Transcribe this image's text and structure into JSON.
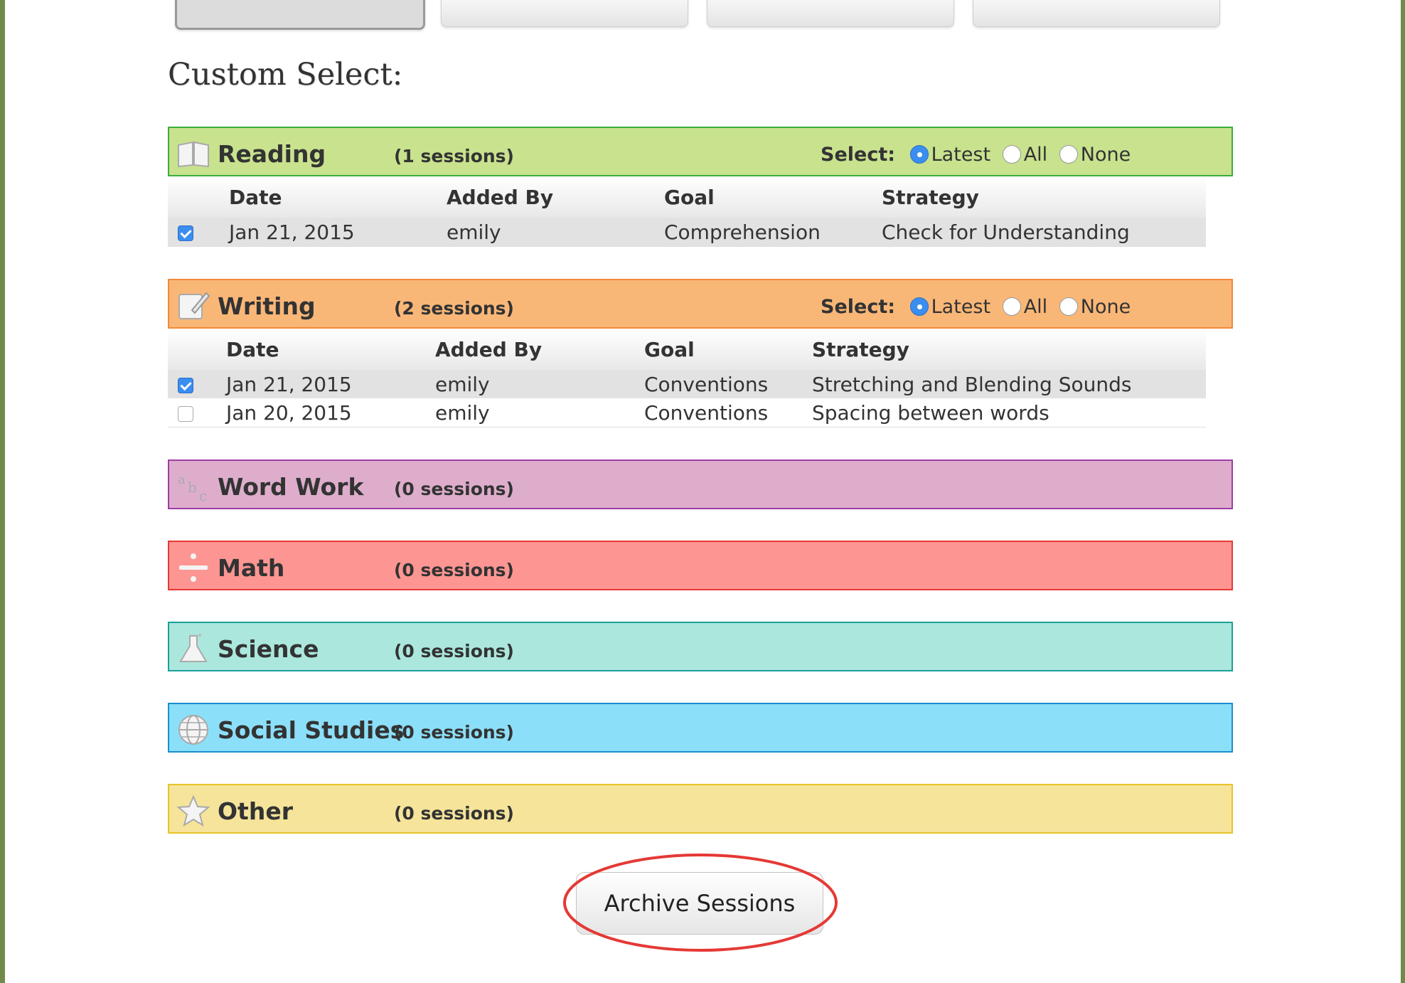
{
  "page": {
    "heading": "Custom Select:",
    "archive_label": "Archive Sessions"
  },
  "colors": {
    "reading": "#c8e28e",
    "writing": "#f9b777",
    "word_work": "#deadcc",
    "math": "#fd9693",
    "science": "#abe7dd",
    "social_studies": "#8cdff8",
    "other": "#f5e49a",
    "annotation": "#e53935"
  },
  "select": {
    "label": "Select:",
    "latest": "Latest",
    "all": "All",
    "none": "None"
  },
  "subjects": [
    {
      "name": "Reading",
      "count": "(1 sessions)",
      "icon": "book-icon",
      "selected": "Latest",
      "columns": [
        "Date",
        "Added By",
        "Goal",
        "Strategy"
      ],
      "rows": [
        {
          "checked": true,
          "date": "Jan 21, 2015",
          "added_by": "emily",
          "goal": "Comprehension",
          "strategy": "Check for Understanding"
        }
      ]
    },
    {
      "name": "Writing",
      "count": "(2 sessions)",
      "icon": "notepad-pencil-icon",
      "selected": "Latest",
      "columns": [
        "Date",
        "Added By",
        "Goal",
        "Strategy"
      ],
      "rows": [
        {
          "checked": true,
          "date": "Jan 21, 2015",
          "added_by": "emily",
          "goal": "Conventions",
          "strategy": "Stretching and Blending Sounds"
        },
        {
          "checked": false,
          "date": "Jan 20, 2015",
          "added_by": "emily",
          "goal": "Conventions",
          "strategy": "Spacing between words"
        }
      ]
    },
    {
      "name": "Word Work",
      "count": "(0 sessions)",
      "icon": "abc-letters-icon"
    },
    {
      "name": "Math",
      "count": "(0 sessions)",
      "icon": "divide-icon"
    },
    {
      "name": "Science",
      "count": "(0 sessions)",
      "icon": "flask-icon"
    },
    {
      "name": "Social Studies",
      "count": "(0 sessions)",
      "icon": "globe-icon"
    },
    {
      "name": "Other",
      "count": "(0 sessions)",
      "icon": "star-icon"
    }
  ]
}
